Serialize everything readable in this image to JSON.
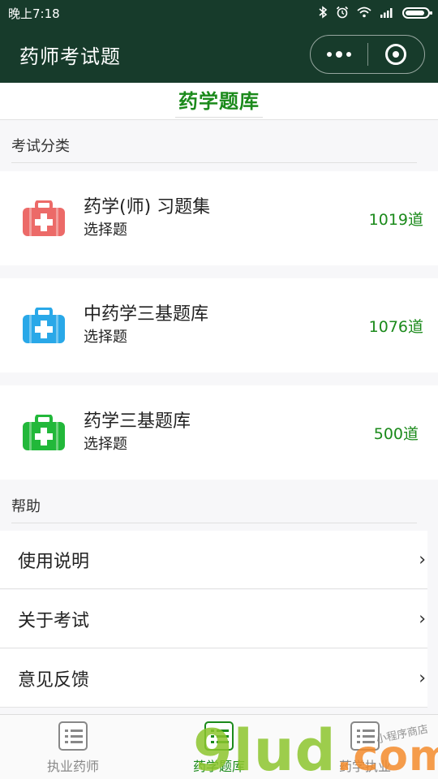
{
  "status_bar": {
    "time": "晚上7:18",
    "icons": [
      "bluetooth-icon",
      "alarm-icon",
      "wifi-icon",
      "signal-icon",
      "battery-icon"
    ],
    "battery_level": 0.9
  },
  "nav_bar": {
    "title": "药师考试题",
    "capsule_icons": [
      "more-dots-icon",
      "close-target-icon"
    ]
  },
  "page_header": {
    "title": "药学题库"
  },
  "sections": {
    "categories_label": "考试分类",
    "help_label": "帮助"
  },
  "categories": [
    {
      "name": "药学(师) 习题集",
      "type": "选择题",
      "count": "1019道",
      "icon": "medical-kit-icon",
      "color": "#ec6a68"
    },
    {
      "name": "中药学三基题库",
      "type": "选择题",
      "count": "1076道",
      "icon": "medical-kit-icon",
      "color": "#29a8e8"
    },
    {
      "name": "药学三基题库",
      "type": "选择题",
      "count": "500道",
      "icon": "medical-kit-icon",
      "color": "#22b83a"
    }
  ],
  "help_items": [
    {
      "label": "使用说明",
      "icon": "chevron-right-icon"
    },
    {
      "label": "关于考试",
      "icon": "chevron-right-icon"
    },
    {
      "label": "意见反馈",
      "icon": "chevron-right-icon"
    }
  ],
  "tabs": [
    {
      "label": "执业药师",
      "icon": "list-icon",
      "active": false
    },
    {
      "label": "药学题库",
      "icon": "list-icon",
      "active": true
    },
    {
      "label": "药学执业",
      "icon": "list-icon",
      "active": false
    }
  ],
  "watermark": {
    "brand": "9lud",
    "suffix": ".com",
    "caption": "小程序商店"
  },
  "colors": {
    "header_bg": "#173b2b",
    "accent_green": "#1b8a1b"
  }
}
